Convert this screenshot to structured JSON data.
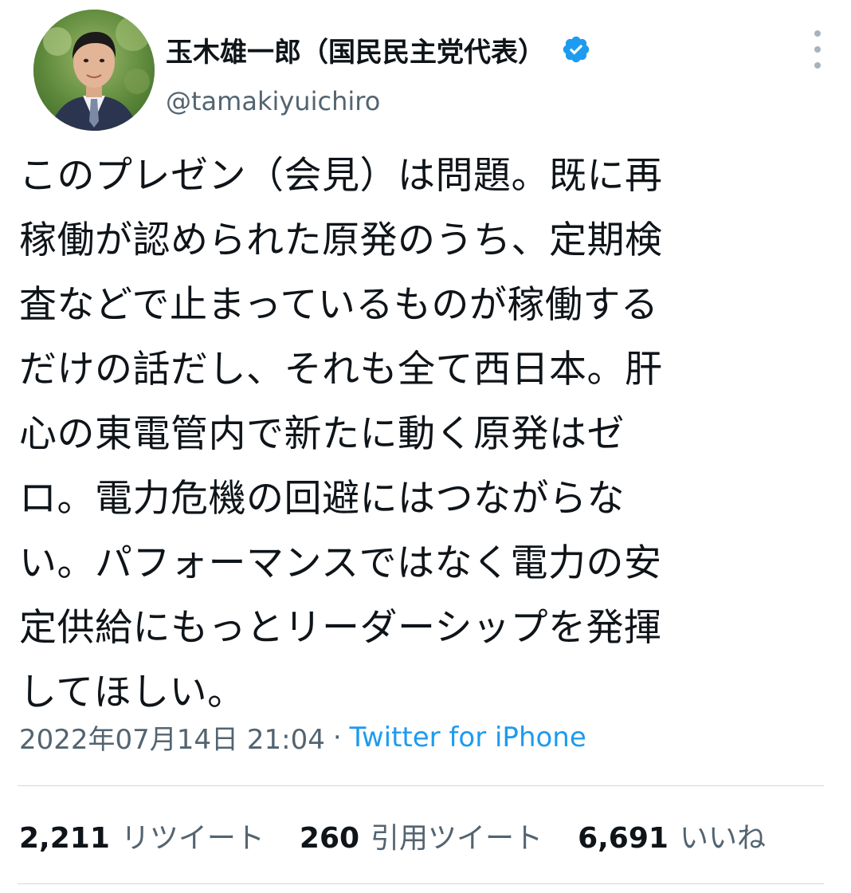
{
  "user": {
    "display_name": "玉木雄一郎（国民民主党代表）",
    "handle": "@tamakiyuichiro",
    "verified_icon": "verified-badge-icon",
    "avatar_icon": "profile-photo"
  },
  "tweet": {
    "lines": [
      "このプレゼン（会見）は問題。既に再",
      "稼働が認められた原発のうち、定期検",
      "査などで止まっているものが稼働する",
      "だけの話だし、それも全て西日本。肝",
      "心の東電管内で新たに動く原発はゼ",
      "ロ。電力危機の回避にはつながらな",
      "い。パフォーマンスではなく電力の安",
      "定供給にもっとリーダーシップを発揮",
      "してほしい。"
    ],
    "timestamp": "2022年07月14日 21:04",
    "separator": "·",
    "source": "Twitter for iPhone"
  },
  "stats": {
    "retweets": {
      "count": "2,211",
      "label": "リツイート"
    },
    "quotes": {
      "count": "260",
      "label": "引用ツイート"
    },
    "likes": {
      "count": "6,691",
      "label": "いいね"
    }
  },
  "colors": {
    "text_primary": "#0f1419",
    "text_secondary": "#536471",
    "accent": "#1d9bf0",
    "divider": "#cfd9de"
  }
}
